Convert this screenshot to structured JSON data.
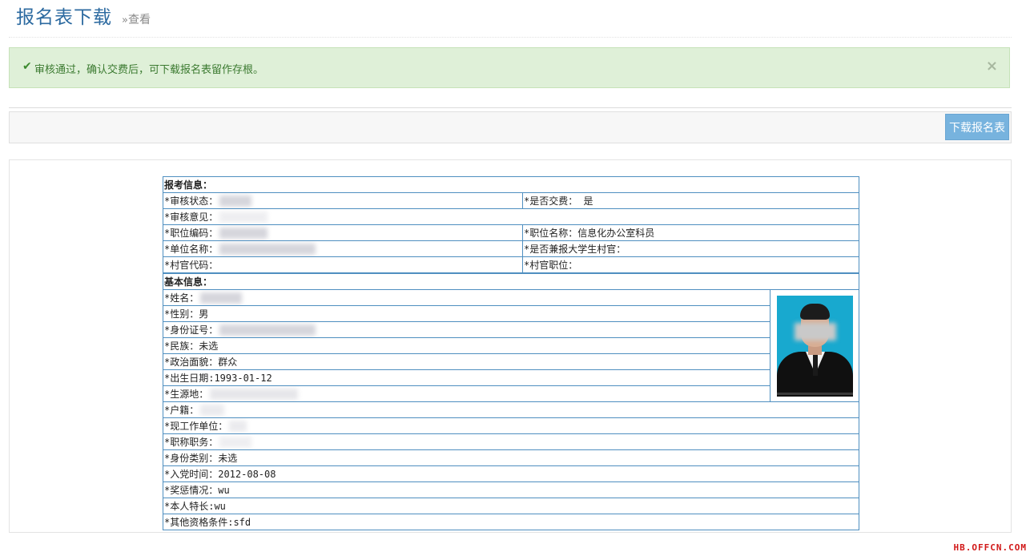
{
  "header": {
    "title": "报名表下载",
    "subtitle_prefix": "»",
    "subtitle": "查看"
  },
  "alert": {
    "check_icon": "✔",
    "message": "审核通过，确认交费后，可下载报名表留作存根。",
    "close_icon": "×"
  },
  "toolbar": {
    "download_label": "下载报名表"
  },
  "form": {
    "exam_section": "报考信息：",
    "basic_section": "基本信息：",
    "fields": {
      "review_status": "*审核状态：",
      "paid": "*是否交费：",
      "paid_value": "是",
      "review_opinion": "*审核意见：",
      "position_code": "*职位编码：",
      "position_name": "*职位名称：",
      "position_name_value": "信息化办公室科员",
      "unit_name": "*单位名称：",
      "also_village": "*是否兼报大学生村官：",
      "village_code": "*村官代码：",
      "village_position": "*村官职位：",
      "name": "*姓名：",
      "gender": "*性别：",
      "gender_value": "男",
      "id_number": "*身份证号：",
      "ethnicity": "*民族：",
      "ethnicity_value": "未选",
      "political": "*政治面貌：",
      "political_value": "群众",
      "birth_date": "*出生日期:",
      "birth_date_value": "1993-01-12",
      "origin": "*生源地：",
      "hukou": "*户籍：",
      "work_unit": "*现工作单位：",
      "title_duty": "*职称职务：",
      "identity_type": "*身份类别：",
      "identity_type_value": "未选",
      "party_date": "*入党时间：",
      "party_date_value": "2012-08-08",
      "rewards": "*奖惩情况：",
      "rewards_value": "wu",
      "specialty": "*本人特长:",
      "specialty_value": "wu",
      "other_qual": "*其他资格条件:",
      "other_qual_value": "sfd"
    }
  },
  "watermark": "HB.OFFCN.COM",
  "colors": {
    "title": "#2c6aa0",
    "alert_bg": "#dff0d8",
    "button_bg": "#77b3de",
    "table_border": "#4f8fc0",
    "watermark": "#d11818"
  }
}
